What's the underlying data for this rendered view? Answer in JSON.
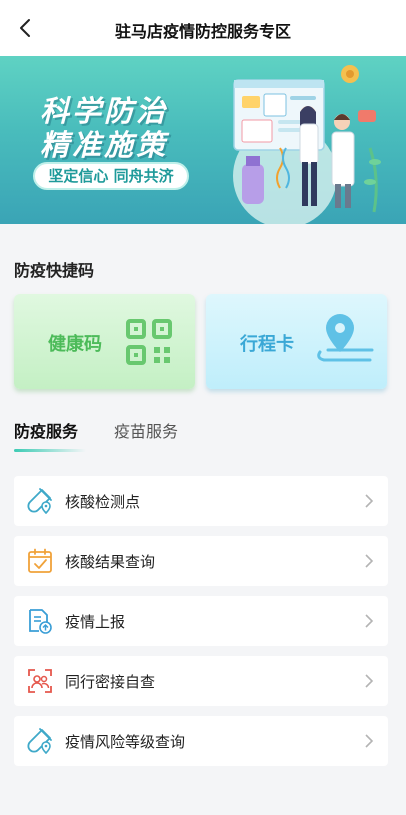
{
  "header": {
    "title": "驻马店疫情防控服务专区",
    "back_icon": "back-arrow-icon"
  },
  "banner": {
    "line1": "科学防治",
    "line2": "精准施策",
    "slogan": "坚定信心 同舟共济"
  },
  "quick_codes": {
    "title": "防疫快捷码",
    "health_code": {
      "label": "健康码",
      "icon": "qr-code-icon"
    },
    "trip_card": {
      "label": "行程卡",
      "icon": "location-pin-icon"
    }
  },
  "tabs": [
    {
      "label": "防疫服务",
      "active": true
    },
    {
      "label": "疫苗服务",
      "active": false
    }
  ],
  "services": [
    {
      "label": "核酸检测点",
      "icon": "test-tube-location-icon"
    },
    {
      "label": "核酸结果查询",
      "icon": "calendar-check-icon"
    },
    {
      "label": "疫情上报",
      "icon": "document-upload-icon"
    },
    {
      "label": "同行密接自查",
      "icon": "people-scan-icon"
    },
    {
      "label": "疫情风险等级查询",
      "icon": "test-tube-location-icon"
    }
  ],
  "colors": {
    "accent": "#3ccbb4",
    "health_green": "#4dbb5a",
    "trip_blue": "#3aa8d6",
    "banner_teal": "#49bcbc"
  }
}
